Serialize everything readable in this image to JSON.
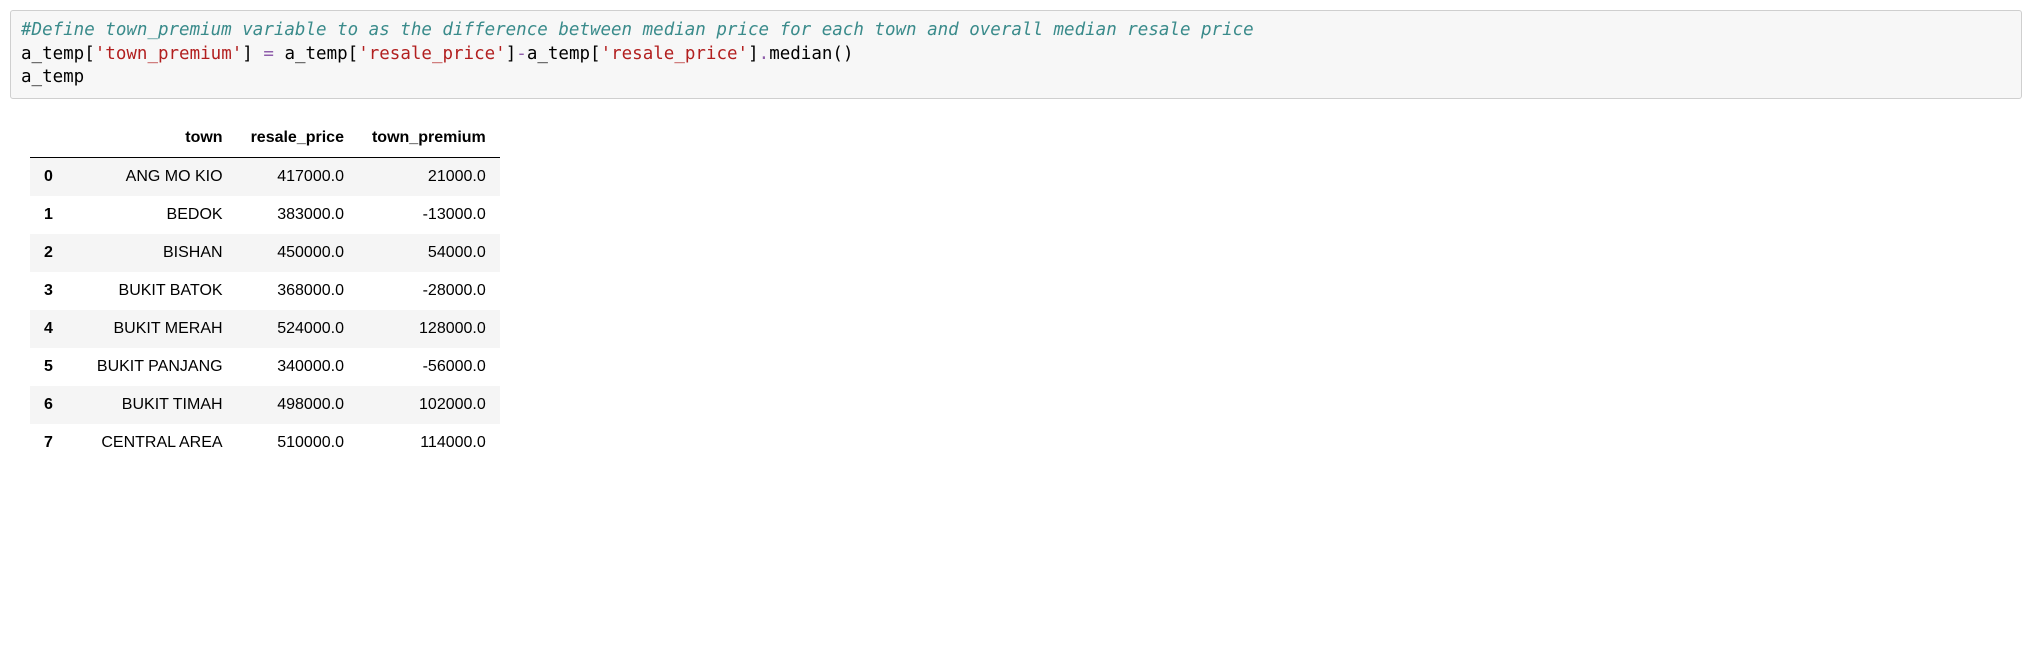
{
  "code": {
    "comment": "#Define town_premium variable to as the difference between median price for each town and overall median resale price",
    "line2_p1": "a_temp[",
    "line2_s1": "'town_premium'",
    "line2_p2": "] ",
    "line2_eq": "=",
    "line2_p3": " a_temp[",
    "line2_s2": "'resale_price'",
    "line2_p4": "]",
    "line2_minus": "-",
    "line2_p5": "a_temp[",
    "line2_s3": "'resale_price'",
    "line2_p6": "]",
    "line2_dot": ".",
    "line2_p7": "median()",
    "line3": "a_temp"
  },
  "table": {
    "columns": [
      "town",
      "resale_price",
      "town_premium"
    ],
    "rows": [
      {
        "idx": "0",
        "town": "ANG MO KIO",
        "resale_price": "417000.0",
        "town_premium": "21000.0"
      },
      {
        "idx": "1",
        "town": "BEDOK",
        "resale_price": "383000.0",
        "town_premium": "-13000.0"
      },
      {
        "idx": "2",
        "town": "BISHAN",
        "resale_price": "450000.0",
        "town_premium": "54000.0"
      },
      {
        "idx": "3",
        "town": "BUKIT BATOK",
        "resale_price": "368000.0",
        "town_premium": "-28000.0"
      },
      {
        "idx": "4",
        "town": "BUKIT MERAH",
        "resale_price": "524000.0",
        "town_premium": "128000.0"
      },
      {
        "idx": "5",
        "town": "BUKIT PANJANG",
        "resale_price": "340000.0",
        "town_premium": "-56000.0"
      },
      {
        "idx": "6",
        "town": "BUKIT TIMAH",
        "resale_price": "498000.0",
        "town_premium": "102000.0"
      },
      {
        "idx": "7",
        "town": "CENTRAL AREA",
        "resale_price": "510000.0",
        "town_premium": "114000.0"
      }
    ]
  }
}
